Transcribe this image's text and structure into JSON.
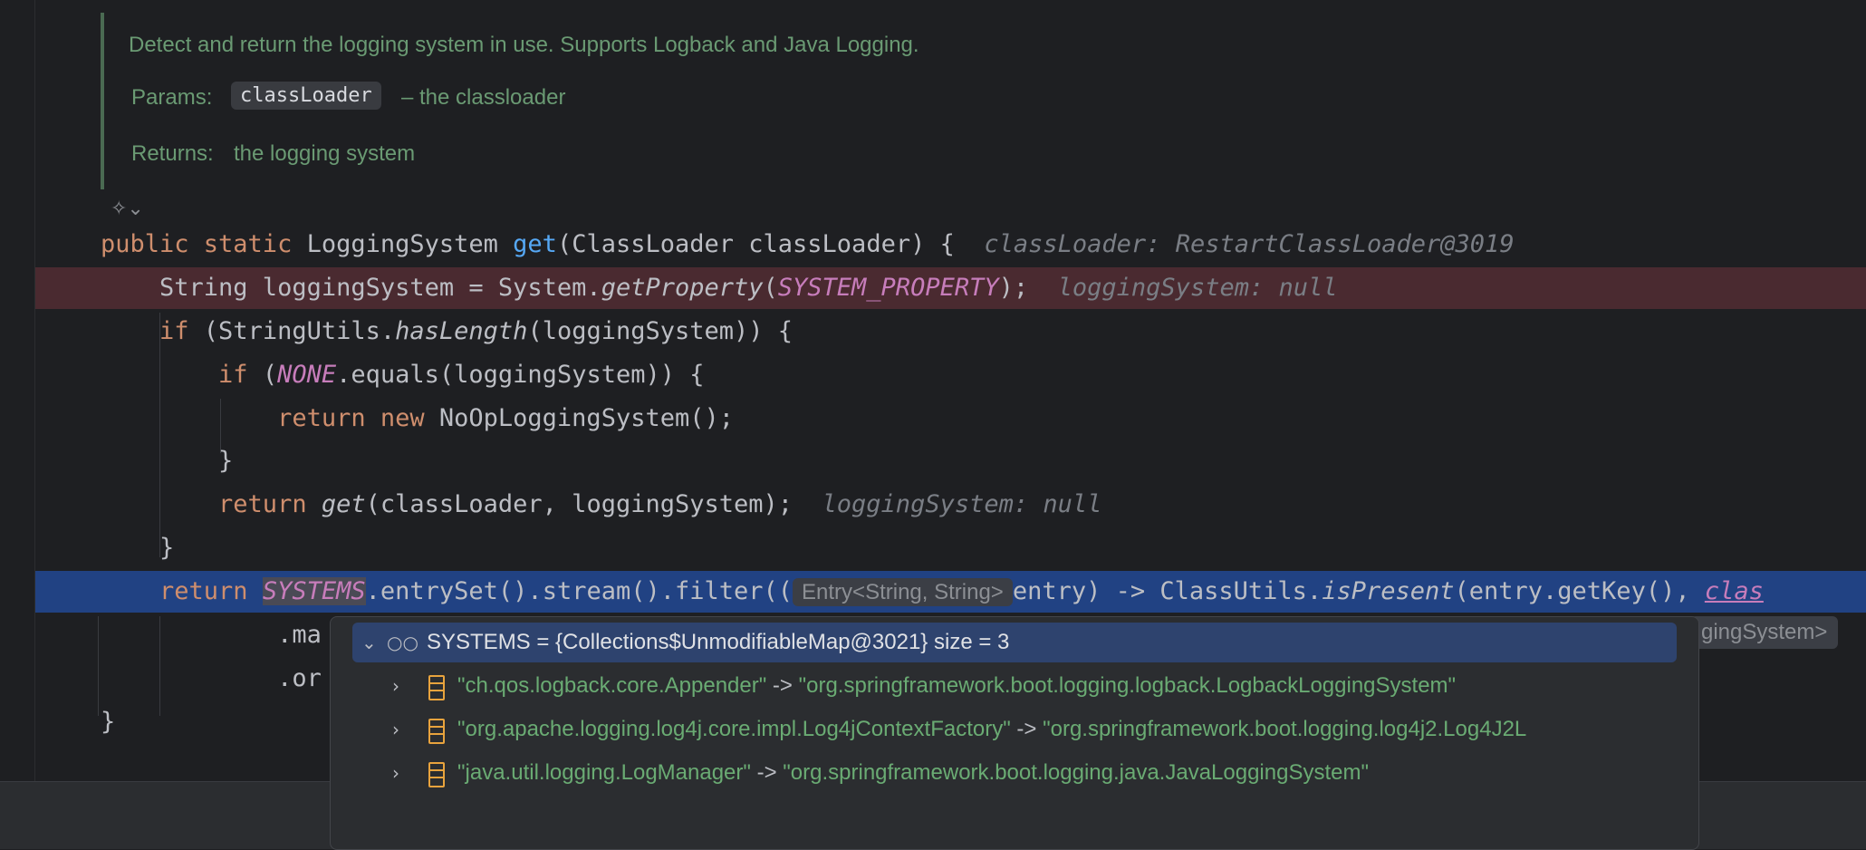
{
  "doc": {
    "summary": "Detect and return the logging system in use. Supports Logback and Java Logging.",
    "params_label": "Params:",
    "param_name": "classLoader",
    "param_desc": "– the classloader",
    "returns_label": "Returns:",
    "returns_desc": "the logging system"
  },
  "code": {
    "l1": {
      "kw": "public static",
      "type": " LoggingSystem ",
      "fn": "get",
      "rest": "(ClassLoader classLoader) {",
      "hint": "classLoader: RestartClassLoader@3019"
    },
    "l2": {
      "a": "    String loggingSystem = System.",
      "m": "getProperty",
      "b": "(",
      "c": "SYSTEM_PROPERTY",
      "d": ");",
      "hint": "loggingSystem: null"
    },
    "l3": {
      "kw": "    if",
      "a": " (StringUtils.",
      "m": "hasLength",
      "b": "(loggingSystem)) {"
    },
    "l4": {
      "kw": "        if",
      "a": " (",
      "c": "NONE",
      "b": ".equals(loggingSystem)) {"
    },
    "l5": {
      "kw": "            return new",
      "a": " NoOpLoggingSystem();"
    },
    "l6": {
      "a": "        }"
    },
    "l7": {
      "kw": "        return",
      "m": " get",
      "a": "(classLoader, loggingSystem);",
      "hint": "loggingSystem: null"
    },
    "l8": {
      "a": "    }"
    },
    "l9": {
      "kw": "    return",
      "c": "SYSTEMS",
      "a": ".entrySet().stream().filter((",
      "hintbox": "Entry<String, String>",
      "b": "entry) -> ClassUtils.",
      "m": "isPresent",
      "d": "(entry.getKey(), ",
      "link": "clas"
    },
    "l10": {
      "a": "            .ma"
    },
    "l11": {
      "a": "            .or"
    },
    "l12": {
      "a": "}"
    },
    "right_hint": "gingSystem>"
  },
  "popup": {
    "root": "SYSTEMS = {Collections$UnmodifiableMap@3021}  size = 3",
    "entries": [
      {
        "key": "\"ch.qos.logback.core.Appender\"",
        "arrow": " -> ",
        "value": "\"org.springframework.boot.logging.logback.LogbackLoggingSystem\""
      },
      {
        "key": "\"org.apache.logging.log4j.core.impl.Log4jContextFactory\"",
        "arrow": " -> ",
        "value": "\"org.springframework.boot.logging.log4j2.Log4J2L"
      },
      {
        "key": "\"java.util.logging.LogManager\"",
        "arrow": " -> ",
        "value": "\"org.springframework.boot.logging.java.JavaLoggingSystem\""
      }
    ]
  },
  "icons": {
    "ai": "ai-assistant-icon",
    "chevron_down": "chevron-down-icon",
    "chevron_right": "chevron-right-icon",
    "watch": "watch-glasses-icon",
    "map_entry": "map-entry-icon"
  },
  "colors": {
    "background": "#1e1f22",
    "keyword": "#cf8e6d",
    "function": "#56a8f5",
    "constant": "#c77dbb",
    "string": "#6aab73",
    "error_line": "#4a2a30",
    "execution_line": "#214283"
  }
}
